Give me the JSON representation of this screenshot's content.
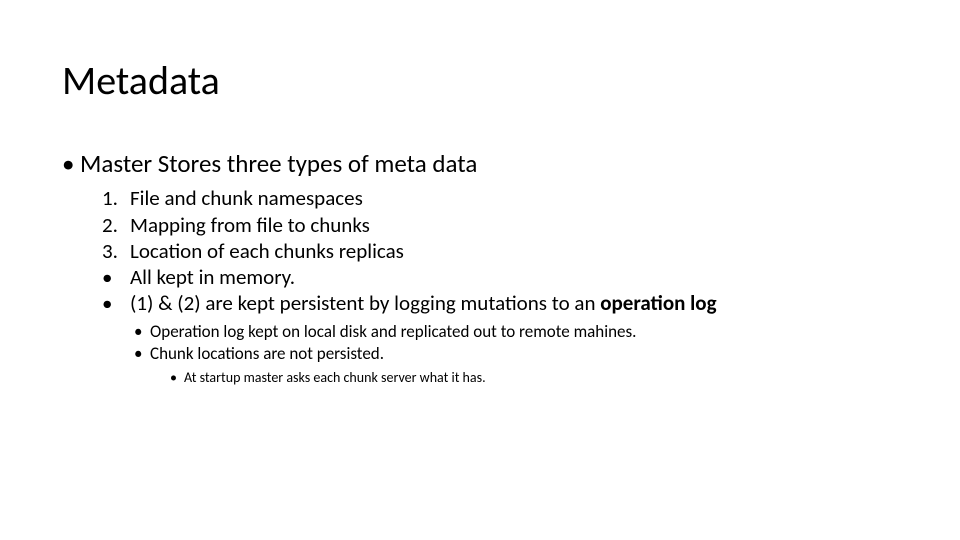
{
  "title": "Metadata",
  "lvl1_bullet": "•",
  "lvl1_text": "Master Stores three types of meta data",
  "items": {
    "i1_marker": "1.",
    "i1_text": "File and chunk namespaces",
    "i2_marker": "2.",
    "i2_text": "Mapping from file to chunks",
    "i3_marker": "3.",
    "i3_text": "Location of each chunks replicas",
    "i4_marker": "•",
    "i4_text": "All kept in memory.",
    "i5_marker": "•",
    "i5_text_a": "(1) & (2) are kept persistent by logging mutations to an ",
    "i5_text_b": "operation log"
  },
  "sub1": {
    "bullet": "•",
    "s1": "Operation log kept on local disk and replicated out to remote mahines.",
    "s2": "Chunk locations are not persisted."
  },
  "sub2": {
    "bullet": "•",
    "s1": "At startup master asks each chunk server what it has."
  }
}
